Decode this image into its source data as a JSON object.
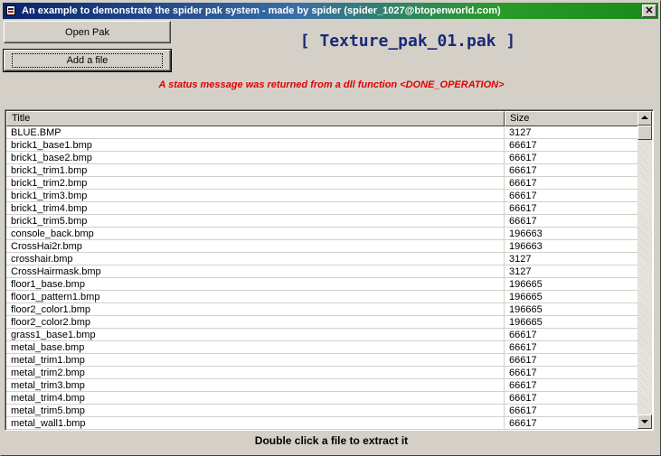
{
  "window": {
    "title": "An example to demonstrate the spider pak system - made by spider (spider_1027@btopenworld.com)",
    "close_label": "✕"
  },
  "toolbar": {
    "open_pak_label": "Open Pak",
    "add_file_label": "Add a file"
  },
  "pak_title": "[ Texture_pak_01.pak ]",
  "status_message": "A status message was returned from a dll function <DONE_OPERATION>",
  "list": {
    "columns": [
      "Title",
      "Size"
    ],
    "rows": [
      {
        "title": "BLUE.BMP",
        "size": "3127"
      },
      {
        "title": "brick1_base1.bmp",
        "size": "66617"
      },
      {
        "title": "brick1_base2.bmp",
        "size": "66617"
      },
      {
        "title": "brick1_trim1.bmp",
        "size": "66617"
      },
      {
        "title": "brick1_trim2.bmp",
        "size": "66617"
      },
      {
        "title": "brick1_trim3.bmp",
        "size": "66617"
      },
      {
        "title": "brick1_trim4.bmp",
        "size": "66617"
      },
      {
        "title": "brick1_trim5.bmp",
        "size": "66617"
      },
      {
        "title": "console_back.bmp",
        "size": "196663"
      },
      {
        "title": "CrossHai2r.bmp",
        "size": "196663"
      },
      {
        "title": "crosshair.bmp",
        "size": "3127"
      },
      {
        "title": "CrossHairmask.bmp",
        "size": "3127"
      },
      {
        "title": "floor1_base.bmp",
        "size": "196665"
      },
      {
        "title": "floor1_pattern1.bmp",
        "size": "196665"
      },
      {
        "title": "floor2_color1.bmp",
        "size": "196665"
      },
      {
        "title": "floor2_color2.bmp",
        "size": "196665"
      },
      {
        "title": "grass1_base1.bmp",
        "size": "66617"
      },
      {
        "title": "metal_base.bmp",
        "size": "66617"
      },
      {
        "title": "metal_trim1.bmp",
        "size": "66617"
      },
      {
        "title": "metal_trim2.bmp",
        "size": "66617"
      },
      {
        "title": "metal_trim3.bmp",
        "size": "66617"
      },
      {
        "title": "metal_trim4.bmp",
        "size": "66617"
      },
      {
        "title": "metal_trim5.bmp",
        "size": "66617"
      },
      {
        "title": "metal_wall1.bmp",
        "size": "66617"
      }
    ]
  },
  "footer": "Double click a file to extract it",
  "icons": {
    "app": "app-icon",
    "close": "close-icon",
    "scroll_up": "arrow-up-icon",
    "scroll_down": "arrow-down-icon"
  }
}
